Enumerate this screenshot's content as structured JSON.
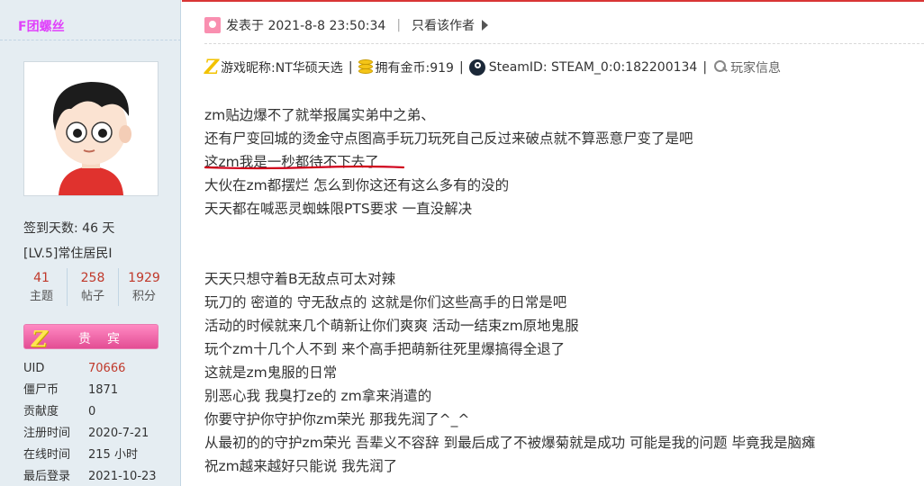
{
  "user": {
    "name": "F团螺丝",
    "sign_days": "签到天数: 46 天",
    "level": "[LV.5]常住居民I",
    "counts": [
      {
        "num": "41",
        "label": "主题"
      },
      {
        "num": "258",
        "label": "帖子"
      },
      {
        "num": "1929",
        "label": "积分"
      }
    ],
    "vip_badge": "贵宾",
    "info": [
      {
        "key": "UID",
        "value": "70666"
      },
      {
        "key": "僵尸币",
        "value": "1871"
      },
      {
        "key": "贡献度",
        "value": "0"
      },
      {
        "key": "注册时间",
        "value": "2020-7-21"
      },
      {
        "key": "在线时间",
        "value": "215 小时"
      },
      {
        "key": "最后登录",
        "value": "2021-10-23"
      }
    ]
  },
  "post": {
    "posted_at": "发表于 2021-8-8 23:50:34",
    "only_author": "只看该作者",
    "game_nick": "游戏昵称:NT华硕天选",
    "coins": "拥有金币:919",
    "steam_id": "SteamID: STEAM_0:0:182200134",
    "player_info": "玩家信息",
    "lines": [
      "zm贴边爆不了就举报属实弟中之弟、",
      "还有尸变回城的烫金守点图高手玩刀玩死自己反过来破点就不算恶意尸变了是吧",
      "这zm我是一秒都待不下去了",
      "大伙在zm都摆烂  怎么到你这还有这么多有的没的",
      "天天都在喊恶灵蜘蛛限PTS要求  一直没解决",
      "",
      "",
      "天天只想守着B无敌点可太对辣",
      "玩刀的  密道的  守无敌点的  这就是你们这些高手的日常是吧",
      "活动的时候就来几个萌新让你们爽爽  活动一结束zm原地鬼服",
      "玩个zm十几个人不到  来个高手把萌新往死里爆搞得全退了",
      "这就是zm鬼服的日常",
      "别恶心我 我臭打ze的  zm拿来消遣的",
      "你要守护你守护你zm荣光  那我先润了^_^",
      "从最初的的守护zm荣光  吾辈义不容辞  到最后成了不被爆菊就是成功  可能是我的问题  毕竟我是脑瘫",
      "祝zm越来越好只能说  我先润了"
    ],
    "underline_color": "#d0021b"
  }
}
